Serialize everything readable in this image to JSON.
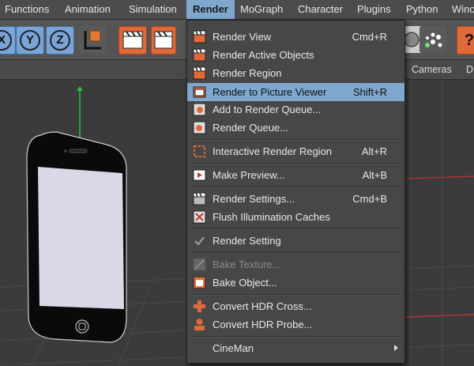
{
  "menubar": {
    "items": [
      {
        "label": "Functions"
      },
      {
        "label": "Animation"
      },
      {
        "label": "Simulation"
      },
      {
        "label": "Render"
      },
      {
        "label": "MoGraph"
      },
      {
        "label": "Character"
      },
      {
        "label": "Plugins"
      },
      {
        "label": "Python"
      },
      {
        "label": "Winc"
      }
    ],
    "active": "Render"
  },
  "toolbar": {
    "axis_x": "X",
    "axis_y": "Y",
    "axis_z": "Z",
    "help": "?"
  },
  "viewport": {
    "cameras_label": "Cameras",
    "d_label": "D"
  },
  "render_menu": {
    "items": [
      {
        "label": "Render View",
        "shortcut": "Cmd+R",
        "icon": "clapper-icon"
      },
      {
        "label": "Render Active Objects",
        "shortcut": "",
        "icon": "clapper-icon"
      },
      {
        "label": "Render Region",
        "shortcut": "",
        "icon": "clapper-icon"
      },
      {
        "label": "Render to Picture Viewer",
        "shortcut": "Shift+R",
        "icon": "picture-viewer-icon",
        "highlighted": true
      },
      {
        "label": "Add to Render Queue...",
        "shortcut": "",
        "icon": "render-queue-add-icon"
      },
      {
        "label": "Render Queue...",
        "shortcut": "",
        "icon": "render-queue-icon"
      },
      {
        "label": "Interactive Render Region",
        "shortcut": "Alt+R",
        "icon": "region-icon"
      },
      {
        "label": "Make Preview...",
        "shortcut": "Alt+B",
        "icon": "preview-icon"
      },
      {
        "label": "Render Settings...",
        "shortcut": "Cmd+B",
        "icon": "settings-clapper-icon"
      },
      {
        "label": "Flush Illumination Caches",
        "shortcut": "",
        "icon": "flush-icon"
      },
      {
        "label": "Render Setting",
        "shortcut": "",
        "icon": "check-icon"
      },
      {
        "label": "Bake Texture...",
        "shortcut": "",
        "icon": "bake-texture-icon",
        "disabled": true
      },
      {
        "label": "Bake Object...",
        "shortcut": "",
        "icon": "bake-object-icon"
      },
      {
        "label": "Convert HDR Cross...",
        "shortcut": "",
        "icon": "hdr-cross-icon"
      },
      {
        "label": "Convert HDR Probe...",
        "shortcut": "",
        "icon": "hdr-probe-icon"
      },
      {
        "label": "CineMan",
        "shortcut": "",
        "icon": "",
        "submenu": true
      }
    ]
  },
  "colors": {
    "menu_bg": "#474747",
    "highlight": "#7fa7cf",
    "accent_orange": "#e0693a"
  }
}
